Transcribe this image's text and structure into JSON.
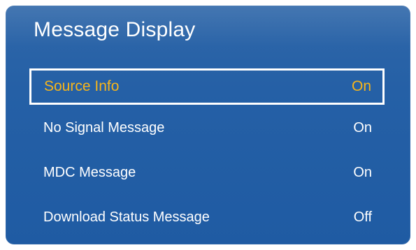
{
  "window": {
    "title": "Message Display"
  },
  "menu": {
    "items": [
      {
        "label": "Source Info",
        "value": "On",
        "selected": true
      },
      {
        "label": "No Signal Message",
        "value": "On",
        "selected": false
      },
      {
        "label": "MDC Message",
        "value": "On",
        "selected": false
      },
      {
        "label": "Download Status Message",
        "value": "Off",
        "selected": false
      }
    ]
  },
  "colors": {
    "panel_background": "#2560a6",
    "selected_text": "#f7b51a",
    "text": "#ffffff",
    "selection_border": "#ffffff"
  }
}
